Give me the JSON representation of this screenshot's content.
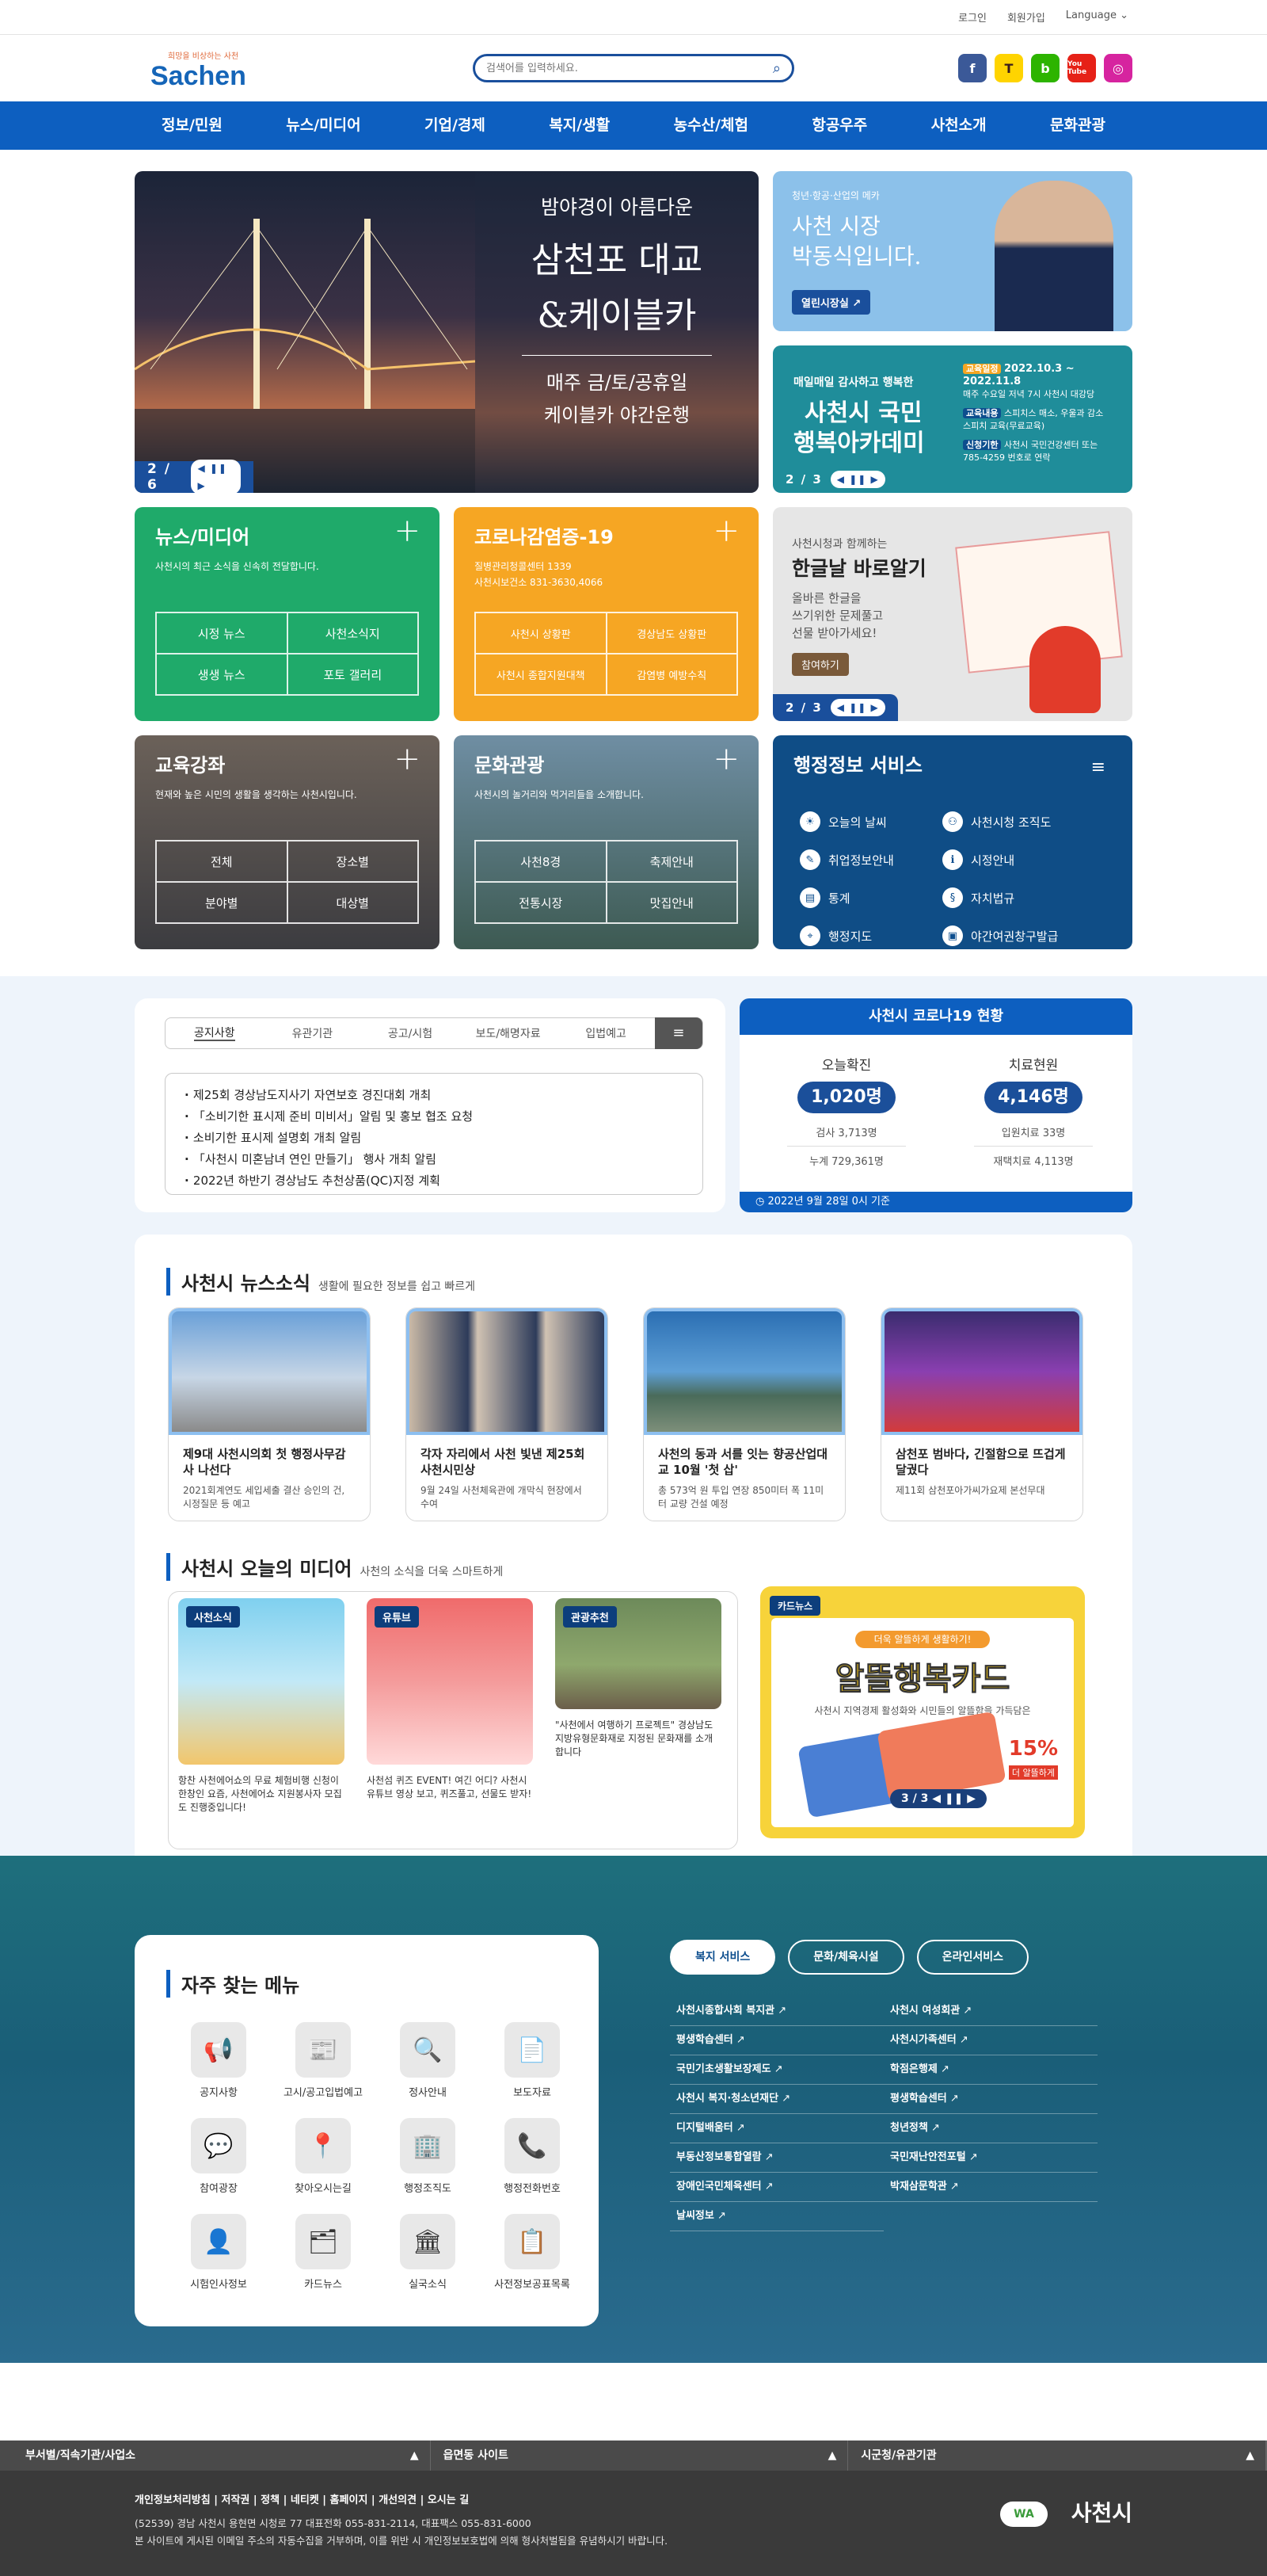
{
  "topbar": {
    "login": "로그인",
    "join": "회원가입",
    "language": "Language"
  },
  "logo": {
    "tagline": "희망을 비상하는 사천",
    "name": "Sachen"
  },
  "search": {
    "placeholder": "검색어를 입력하세요."
  },
  "sns": [
    "f",
    "T",
    "b",
    "You Tube",
    "◎"
  ],
  "gnb": [
    "정보/민원",
    "뉴스/미디어",
    "기업/경제",
    "복지/생활",
    "농수산/체험",
    "항공우주",
    "사천소개",
    "문화관광"
  ],
  "hero": {
    "line1": "밤야경이 아름다운",
    "line2": "삼천포 대교",
    "line3": "&케이블카",
    "line4": "매주 금/토/공휴일",
    "line5": "케이블카 야간운행",
    "pager": "2 / 6"
  },
  "mayor": {
    "small": "청년·항공·산업의 메카",
    "line1": "사천 시장",
    "line2": "박동식입니다.",
    "button": "열린시장실"
  },
  "academy": {
    "line1": "매일매일 감사하고 행복한",
    "line2": "사천시 국민",
    "line3": "행복아카데미",
    "d1tag": "교육일정",
    "d1": "2022.10.3 ~ 2022.11.8",
    "d1b": "매주 수요일 저녁 7시 사천시 대강당",
    "d2tag": "교육내용",
    "d2": "스피치스 매소, 우울과 감소",
    "d2b": "스피치 교육(무료교육)",
    "d3tag": "신청기한",
    "d3": "사천시 국민건강센터 또는",
    "d3b": "785-4259 번호로 연락",
    "pager": "2 / 3"
  },
  "newsbox": {
    "title": "뉴스/미디어",
    "sub": "사천시의 최근 소식을 신속히 전달합니다.",
    "links": [
      "시정 뉴스",
      "사천소식지",
      "생생 뉴스",
      "포토 갤러리"
    ]
  },
  "covidbox": {
    "title": "코로나감염증-19",
    "sub1": "질병관리청콜센터 1339",
    "sub2": "사천시보건소 831-3630,4066",
    "links": [
      "사천시 상황판",
      "경상남도 상황판",
      "사천시 종합지원대책",
      "감염병 예방수칙"
    ]
  },
  "hangul": {
    "small": "사천시청과 함께하는",
    "title": "한글날 바로알기",
    "desc1": "올바른 한글을",
    "desc2": "쓰기위한 문제풀고",
    "desc3": "선물 받아가세요!",
    "button": "참여하기",
    "pager": "2 / 3"
  },
  "edubox": {
    "title": "교육강좌",
    "sub": "현재와 높은 시민의 생활을 생각하는 사천시입니다.",
    "links": [
      "전체",
      "장소별",
      "분야별",
      "대상별"
    ]
  },
  "tourbox": {
    "title": "문화관광",
    "sub": "사천시의 놀거리와 먹거리들을 소개합니다.",
    "links": [
      "사천8경",
      "축제안내",
      "전통시장",
      "맛집안내"
    ]
  },
  "admin": {
    "title": "행정정보 서비스",
    "items": [
      "오늘의 날씨",
      "사천시청 조직도",
      "취업정보안내",
      "시정안내",
      "통계",
      "자치법규",
      "행정지도",
      "야간여권창구발급"
    ]
  },
  "noticeTabs": [
    "공지사항",
    "유관기관",
    "공고/시험",
    "보도/해명자료",
    "입법예고"
  ],
  "notices": [
    "제25회 경상남도지사기 자연보호 경진대회 개최",
    "「소비기한 표시제 준비 미비서」알림 및 홍보 협조 요청",
    "소비기한 표시제 설명회 개최 알림",
    "「사천시 미혼남녀 연인 만들기」 행사 개최 알림",
    "2022년 하반기 경상남도 추천상품(QC)지정 계획"
  ],
  "covid": {
    "title": "사천시 코로나19 현황",
    "todayLabel": "오늘확진",
    "today": "1,020명",
    "treatLabel": "치료현원",
    "treat": "4,146명",
    "cum1": "검사 3,713명",
    "cum2": "누계 729,361명",
    "t1": "입원치료 33명",
    "t2": "재택치료 4,113명",
    "date": "2022년 9월 28일 0시 기준"
  },
  "newsSection": {
    "title": "사천시 뉴스소식",
    "sub": "생활에 필요한 정보를 쉽고 빠르게",
    "items": [
      {
        "title": "제9대 사천시의회 첫 행정사무감사 나선다",
        "desc": "2021회계연도 세입세출 결산 승인의 건, 시정질문 등 예고"
      },
      {
        "title": "각자 자리에서 사천 빛낸 제25회 사천시민상",
        "desc": "9월 24일 사천체육관에 개막식 현장에서 수여"
      },
      {
        "title": "사천의 동과 서를 잇는 향공산업대교 10월 '첫 삽'",
        "desc": "총 573억 원 투입 연장 850미터 폭 11미터 교량 건설 예정"
      },
      {
        "title": "삼천포 범바다, 긴절함으로 뜨겁게 달궜다",
        "desc": "제11회 삼천포아가씨가요제 본선무대"
      }
    ]
  },
  "mediaSection": {
    "title": "사천시 오늘의 미디어",
    "sub": "사천의 소식을 더욱 스마트하게",
    "items": [
      {
        "badge": "사천소식",
        "cap": "항찬 사천에어쇼의 무료 체험비행 신청이 한창인 요즘, 사천에어쇼 지원봉사자 모집도 진행중입니다!"
      },
      {
        "badge": "유튜브",
        "cap": "사천섬 퀴즈 EVENT! 여긴 어디? 사천시 유튜브 영상 보고, 퀴즈풀고, 선물도 받자!"
      },
      {
        "badge": "관광추천",
        "cap": "\"사천에서 여행하기 프로젝트\" 경상남도 지방유형문화재로 지정된 문화재를 소개합니다"
      }
    ],
    "card": {
      "badge": "카드뉴스",
      "pill": "더욱 알뜰하게 생활하기!",
      "title": "알뜰행복카드",
      "desc": "사천시 지역경제 활성화와 시민들의 알뜰함을 가득담은",
      "pct": "15%",
      "pctsub": "더 알뜰하게",
      "pager": "3 / 3"
    }
  },
  "fav": {
    "title": "자주 찾는 메뉴",
    "items": [
      "공지사항",
      "고시/공고입법예고",
      "정사안내",
      "보도자료",
      "참여광장",
      "찾아오시는길",
      "행정조직도",
      "행정전화번호",
      "시험인사정보",
      "카드뉴스",
      "실국소식",
      "사전정보공표목록"
    ],
    "icons": [
      "📢",
      "📰",
      "🔍",
      "📄",
      "💬",
      "📍",
      "🏢",
      "📞",
      "👤",
      "🗂",
      "🏛",
      "📋"
    ]
  },
  "welfare": {
    "tabs": [
      "복지 서비스",
      "문화/체육시설",
      "온라인서비스"
    ],
    "links": [
      "사천시종합사회 복지관",
      "사천시 여성회관",
      "평생학습센터",
      "사천시가족센터",
      "국민기초생활보장제도",
      "학점은행제",
      "사천시 복지·청소년재단",
      "평생학습센터",
      "디지털배움터",
      "청년정책",
      "부동산정보통합열람",
      "국민재난안전포털",
      "장애인국민체육센터",
      "박재삼문학관",
      "날씨정보"
    ]
  },
  "sitebar": [
    "부서별/직속기관/사업소",
    "읍면동 사이트",
    "시군청/유관기관"
  ],
  "footer": {
    "menu": "개인정보처리방침 | 저작권 | 정책 | 네티켓 | 홈페이지 | 개선의견 | 오시는 길",
    "addr1": "(52539) 경남 사천시 용현면 시청로 77 대표전화 055-831-2114, 대표팩스 055-831-6000",
    "addr2": "본 사이트에 게시된 이메일 주소의 자동수집을 거부하며, 이를 위반 시 개인정보보호법에 의해 형사처벌됨을 유념하시기 바랍니다.",
    "brand": "사천시"
  }
}
